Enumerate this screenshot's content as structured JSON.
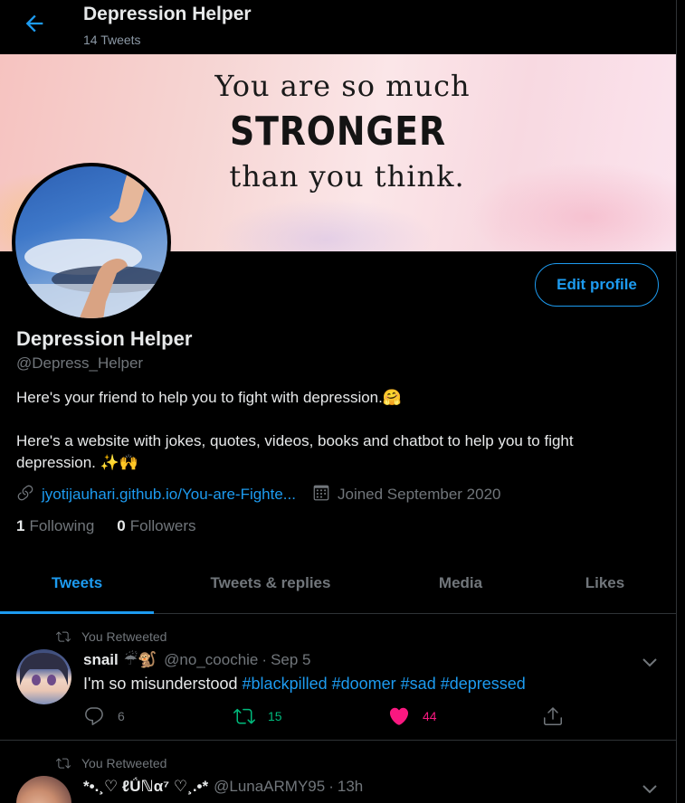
{
  "header": {
    "title": "Depression Helper",
    "tweet_count": "14 Tweets"
  },
  "banner": {
    "line1": "You are so much",
    "line2": "STRONGER",
    "line3": "than you think."
  },
  "profile": {
    "edit_label": "Edit profile",
    "name": "Depression Helper",
    "handle": "@Depress_Helper",
    "bio_line1": "Here's your friend to help you to fight with depression.🤗",
    "bio_line2": "Here's a website with jokes, quotes, videos, books and chatbot to help you to fight depression. ✨🙌",
    "link": "jyotijauhari.github.io/You-are-Fighte...",
    "joined": "Joined September 2020",
    "following_count": "1",
    "following_label": "Following",
    "followers_count": "0",
    "followers_label": "Followers"
  },
  "tabs": [
    {
      "label": "Tweets"
    },
    {
      "label": "Tweets & replies"
    },
    {
      "label": "Media"
    },
    {
      "label": "Likes"
    }
  ],
  "tweets": [
    {
      "retweet_label": "You Retweeted",
      "display_name": "snail",
      "name_emoji": "☔🐒",
      "handle": "@no_coochie",
      "sep": "·",
      "time": "Sep 5",
      "text": "I'm so misunderstood",
      "tags": [
        "#blackpilled",
        "#doomer",
        "#sad",
        "#depressed"
      ],
      "reply_count": "6",
      "retweet_count": "15",
      "like_count": "44"
    },
    {
      "retweet_label": "You Retweeted",
      "display_name": "*•.¸♡ ℓǗℕα⁷ ♡¸.•*",
      "handle": "@LunaARMY95",
      "sep": "·",
      "time": "13h"
    }
  ],
  "colors": {
    "accent": "#1d9bf0",
    "retweet_green": "#00ba7c",
    "like_pink": "#f91880",
    "muted": "#71767b"
  }
}
